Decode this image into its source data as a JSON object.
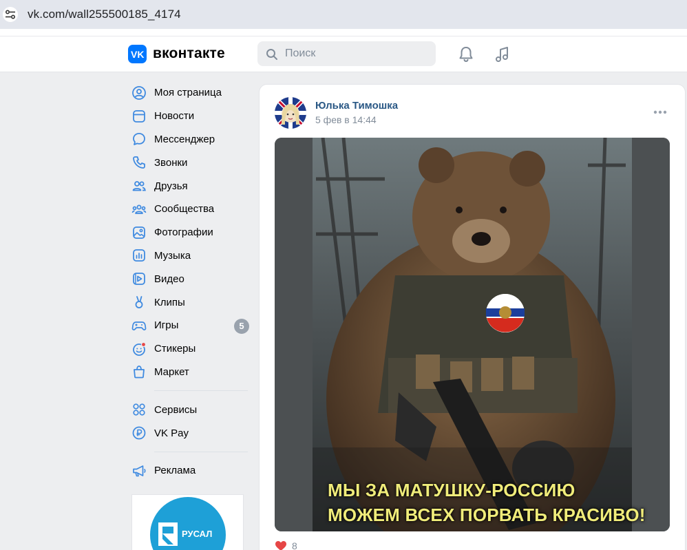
{
  "browser": {
    "url": "vk.com/wall255500185_4174",
    "site_settings_icon": "tune-icon"
  },
  "header": {
    "logo_text": "вконтакте",
    "search_placeholder": "Поиск",
    "notifications_icon": "bell-icon",
    "music_icon": "music-note-icon",
    "accent": "#0077ff"
  },
  "sidebar": {
    "items": [
      {
        "label": "Моя страница",
        "icon": "user-circle-icon"
      },
      {
        "label": "Новости",
        "icon": "news-feed-icon"
      },
      {
        "label": "Мессенджер",
        "icon": "message-icon"
      },
      {
        "label": "Звонки",
        "icon": "phone-icon"
      },
      {
        "label": "Друзья",
        "icon": "friends-icon"
      },
      {
        "label": "Сообщества",
        "icon": "communities-icon"
      },
      {
        "label": "Фотографии",
        "icon": "photo-icon"
      },
      {
        "label": "Музыка",
        "icon": "music-icon"
      },
      {
        "label": "Видео",
        "icon": "video-icon"
      },
      {
        "label": "Клипы",
        "icon": "clips-icon"
      },
      {
        "label": "Игры",
        "icon": "gamepad-icon",
        "badge": "5"
      },
      {
        "label": "Стикеры",
        "icon": "sticker-icon"
      },
      {
        "label": "Маркет",
        "icon": "market-bag-icon"
      }
    ],
    "services": [
      {
        "label": "Сервисы",
        "icon": "services-grid-icon"
      },
      {
        "label": "VK Pay",
        "icon": "vkpay-icon"
      }
    ],
    "ads": [
      {
        "label": "Реклама",
        "icon": "megaphone-icon"
      }
    ],
    "ad_logo_text": "РУСАЛ"
  },
  "post": {
    "author": "Юлька Тимошка",
    "date": "5 фев в 14:44",
    "more_icon": "more-horizontal-icon",
    "image_caption_line1": "МЫ ЗА МАТУШКУ-РОССИЮ",
    "image_caption_line2": "МОЖЕМ ВСЕХ ПОРВАТЬ КРАСИВО!",
    "likes_count": "8",
    "like_color": "#e64646"
  }
}
